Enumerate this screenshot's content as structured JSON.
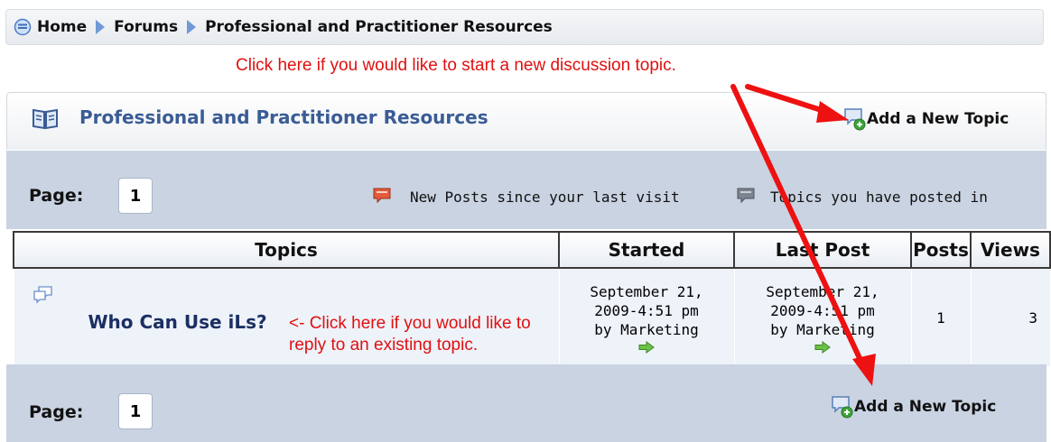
{
  "breadcrumb": {
    "items": [
      "Home",
      "Forums",
      "Professional and Practitioner Resources"
    ]
  },
  "annotations": {
    "new_topic_note": "Click here if you would like to start a new discussion topic.",
    "reply_note": "<- Click here if you would like to reply to an existing topic."
  },
  "forum": {
    "title": "Professional and Practitioner Resources",
    "add_topic_label": "Add a New Topic"
  },
  "pager": {
    "label": "Page:",
    "current_page": "1"
  },
  "legend": {
    "new_posts": "New Posts since your last visit",
    "posted_in": "Topics you have posted in"
  },
  "table": {
    "headers": [
      "Topics",
      "Started",
      "Last Post",
      "Posts",
      "Views"
    ],
    "rows": [
      {
        "topic": "Who Can Use iLs?",
        "started_date": "September 21,",
        "started_time": "2009-4:51 pm",
        "started_by": "by Marketing",
        "last_date": "September 21,",
        "last_time": "2009-4:51 pm",
        "last_by": "by Marketing",
        "posts": "1",
        "views": "3"
      }
    ]
  },
  "colors": {
    "annotation_red": "#e01010",
    "title_blue": "#3a5c95",
    "band": "#c9d3e2"
  },
  "icons": [
    "circle-arrow-down-icon",
    "breadcrumb-arrow-icon",
    "open-book-icon",
    "new-topic-speech-bubble-icon",
    "speech-bubble-red-icon",
    "speech-bubble-gray-icon",
    "topic-bubble-icon",
    "go-to-post-arrow-icon"
  ]
}
